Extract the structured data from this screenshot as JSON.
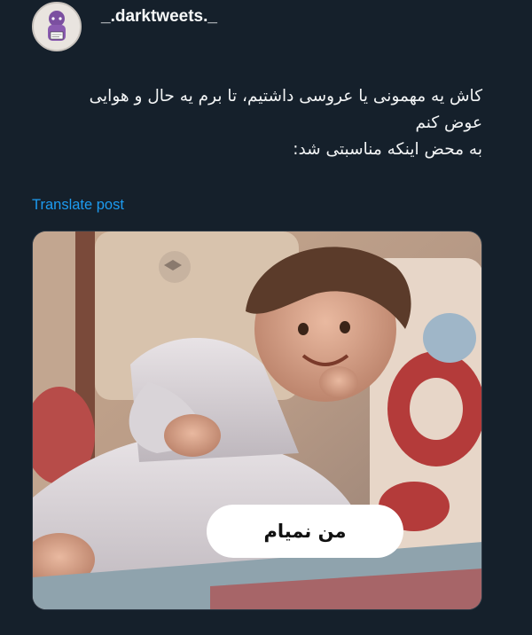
{
  "user": {
    "username": "_.darktweets._",
    "avatar_icon": "profile-avatar-character"
  },
  "tweet": {
    "lines": [
      "کاش یه مهمونی یا عروسی داشتیم، تا برم یه حال و هوایی",
      "عوض کنم",
      "به محض اینکه مناسبتی شد:"
    ],
    "translate_label": "Translate post"
  },
  "media": {
    "caption": "من نمیام"
  },
  "colors": {
    "background": "#15202b",
    "link": "#1d9bf0",
    "text": "#f7f9f9"
  }
}
